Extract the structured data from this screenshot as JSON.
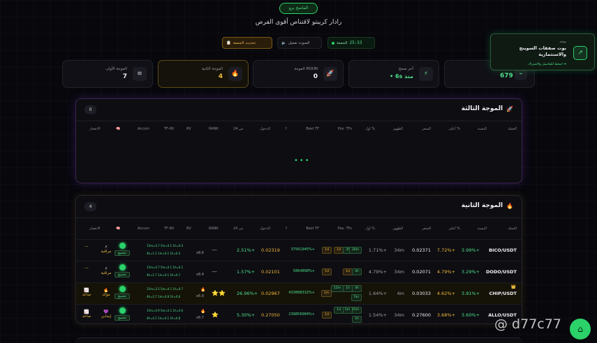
{
  "header": {
    "badge": "الماسح برو",
    "subtitle": "رادار كريبتو لاقتناص أقوى الفرص"
  },
  "controls": {
    "refresh_label": "تحديث الجمعة",
    "refresh_icon": "📋",
    "sound_label": "الصوت تفعيل",
    "sound_icon": "🔈",
    "timer_label": "الجمعة",
    "timer_value": "25:53"
  },
  "stats": [
    {
      "label": "الموجة الأولى",
      "value": "7",
      "icon": "≋"
    },
    {
      "label": "الموجة الثانية",
      "value": "4",
      "icon": "🔥"
    },
    {
      "label": "الموجة ROUN",
      "value": "0",
      "icon": "🚀"
    },
    {
      "label": "آخر مسح",
      "value": "• 6s منذ",
      "icon": "⚡"
    },
    {
      "value": "679",
      "icon": "⌁"
    }
  ],
  "toast": {
    "small": "يوجد",
    "title": "بوت صفقات السوينج والاستثمارية",
    "link": "اضغط للتفاصيل والاشتراك ➜",
    "icon": "↗"
  },
  "wave3": {
    "title": "الموجة الثالثة",
    "icon": "🚀",
    "count": "0",
    "loading": "•••",
    "headers": [
      "العملة",
      "النسبة",
      "أعلى %",
      "السعر",
      "الظهور",
      "أول %",
      "Pos. TFs",
      "Best TF",
      "↑",
      "الدخول",
      "24 س",
      "RANK",
      "RV",
      "TF-RV",
      "Accum",
      "🧠",
      "الانفجار"
    ]
  },
  "wave2": {
    "title": "الموجة الثانية",
    "icon": "🔥",
    "count": "4",
    "headers": [
      "العملة",
      "النسبة",
      "أعلى %",
      "السعر",
      "الظهور",
      "أول %",
      "Pos. TFs",
      "Best TF",
      "↑",
      "الدخول",
      "24 س",
      "RANK",
      "RV",
      "TF-RV",
      "Accum",
      "🧠",
      "الانفجار"
    ],
    "rows": [
      {
        "symbol": "BICO/USDT",
        "crown": "",
        "ratio": "3.99%+",
        "high": "7.72%+",
        "price": "0.02371",
        "seen": "34m",
        "first": "1.71%+",
        "tfs": [
          "1d",
          "3h",
          "30m"
        ],
        "best": "1d",
        "up": "37561945%+",
        "entry": "0.02319",
        "d24": "2.51%+",
        "rank": "—",
        "rank_stars": "",
        "rv": "x8.6",
        "rv_fire": "",
        "tfrv1": "15m=0.7 5m=0.1 1h=0.4",
        "tfrv2": "4h=1.2 1m=0.1 1h=0.3",
        "accum": "تجميع",
        "stat_icon": "⚡",
        "stat": "مراقبة",
        "brk_icon": "",
        "brk": "—"
      },
      {
        "symbol": "DODO/USDT",
        "crown": "",
        "ratio": "3.29%+",
        "high": "4.79%+",
        "price": "0.02071",
        "seen": "34m",
        "first": "4.79%+",
        "tfs": [
          "1d",
          "4h"
        ],
        "best": "1d",
        "up": "5864898%+",
        "entry": "0.02101",
        "d24": "1.57%+",
        "rank": "—",
        "rank_stars": "",
        "rv": "x8.4",
        "rv_fire": "",
        "tfrv1": "15m=0.7 5m=0.1 1h=0.1",
        "tfrv2": "4h=1.7 1m=0.1 1h=0.7",
        "accum": "تجميع",
        "stat_icon": "⚡",
        "stat": "مراقبة",
        "brk_icon": "",
        "brk": "—"
      },
      {
        "symbol": "CHIP/USDT",
        "crown": "👑",
        "ratio": "3.91%+",
        "high": "4.62%+",
        "price": "0.03033",
        "seen": "4m",
        "first": "1.64%+",
        "tfs": [
          "4h",
          "1h",
          "15m",
          "5m"
        ],
        "best": "1m",
        "up": "433898332%+",
        "entry": "0.02967",
        "d24": "26.96%+",
        "rank": "⭐⭐",
        "rank_stars": "⭐⭐",
        "rv": "x6.9",
        "rv_fire": "🔥",
        "tfrv1": "15m=2.5 5m=4.1 1h=0.7",
        "tfrv2": "4h=2.7 1m=0.8 1h=0.6",
        "accum": "تجميع",
        "stat_icon": "🔥",
        "stat": "مؤكد",
        "brk_icon": "📈",
        "brk": "صاعد"
      },
      {
        "symbol": "ALLO/USDT",
        "crown": "",
        "ratio": "3.60%+",
        "high": "3.68%+",
        "price": "0.27600",
        "seen": "34m",
        "first": "1.54%+",
        "tfs": [
          "15m",
          "5m",
          "1d",
          "1h"
        ],
        "best": "1d",
        "up": "239856984%+",
        "entry": "0.27050",
        "d24": "5.30%+",
        "rank": "⭐",
        "rank_stars": "⭐",
        "rv": "x6.7",
        "rv_fire": "🔥",
        "tfrv1": "15m=0.9 5m=0.1 1h=0.6",
        "tfrv2": "4h=4.1 1m=0.1 1h=0.8",
        "accum": "تجميع",
        "stat_icon": "💜",
        "stat": "إيجابي",
        "brk_icon": "📈",
        "brk": "صاعد"
      }
    ]
  },
  "fab_icon": "⌂",
  "watermark": "@ d77c77"
}
